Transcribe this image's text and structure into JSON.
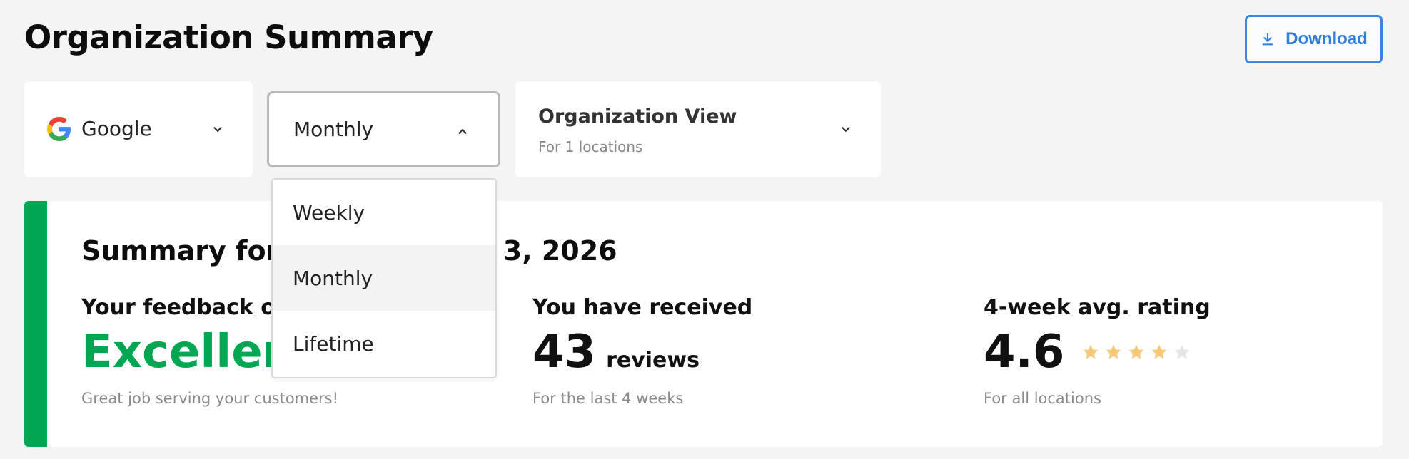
{
  "header": {
    "title": "Organization Summary",
    "download_label": "Download"
  },
  "filters": {
    "source": {
      "label": "Google",
      "icon": "google-logo-icon"
    },
    "period": {
      "selected": "Monthly",
      "options": [
        "Weekly",
        "Monthly",
        "Lifetime"
      ]
    },
    "view": {
      "title": "Organization View",
      "subtitle": "For 1 locations"
    }
  },
  "summary": {
    "title": "Summary for J",
    "title_tail": "3, 2026",
    "feedback": {
      "label": "Your feedback ov",
      "value": "Excellent",
      "note": "Great job serving your customers!"
    },
    "reviews": {
      "label": "You have received",
      "value": "43",
      "unit": "reviews",
      "note": "For the last 4 weeks"
    },
    "rating": {
      "label": "4-week avg. rating",
      "value": "4.6",
      "stars_filled": 4,
      "stars_total": 5,
      "note": "For all locations"
    }
  },
  "colors": {
    "accent_green": "#00a651",
    "primary_blue": "#2f7ddb",
    "star_filled": "#f8c87a",
    "star_empty": "#e6e6e6"
  }
}
